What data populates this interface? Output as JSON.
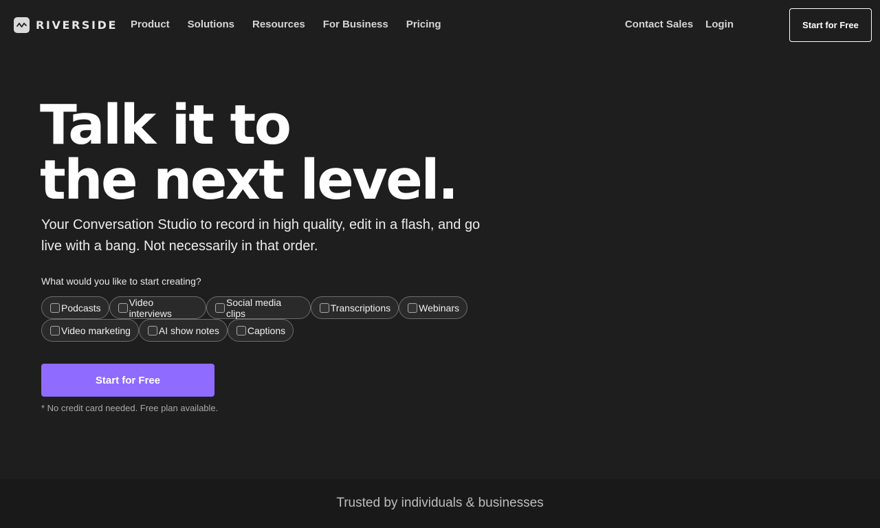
{
  "header": {
    "logo_text": "RIVERSIDE",
    "logo_icon": "waveform-icon",
    "nav": [
      {
        "label": "Product"
      },
      {
        "label": "Solutions"
      },
      {
        "label": "Resources"
      },
      {
        "label": "For Business"
      },
      {
        "label": "Pricing"
      }
    ],
    "contact_sales": "Contact Sales",
    "login": "Login",
    "cta_label": "Start for Free"
  },
  "hero": {
    "title_line1": "Talk it to",
    "title_line2": "the next level.",
    "subtitle": "Your Conversation Studio to record in high quality, edit in a flash, and go live with a bang. Not necessarily in that order.",
    "question": "What would you like to start creating?",
    "options_row1": [
      {
        "label": "Podcasts",
        "checked": false
      },
      {
        "label": "Video interviews",
        "checked": false
      },
      {
        "label": "Social media clips",
        "checked": false
      },
      {
        "label": "Transcriptions",
        "checked": false
      },
      {
        "label": "Webinars",
        "checked": false
      }
    ],
    "options_row2": [
      {
        "label": "Video marketing",
        "checked": false
      },
      {
        "label": "AI show notes",
        "checked": false
      },
      {
        "label": "Captions",
        "checked": false
      }
    ],
    "cta_label": "Start for Free",
    "note": "* No credit card needed. Free plan available."
  },
  "trusted": {
    "text": "Trusted by individuals & businesses"
  },
  "colors": {
    "background": "#1e1e1e",
    "accent": "#8f6bff",
    "band": "#191919"
  }
}
